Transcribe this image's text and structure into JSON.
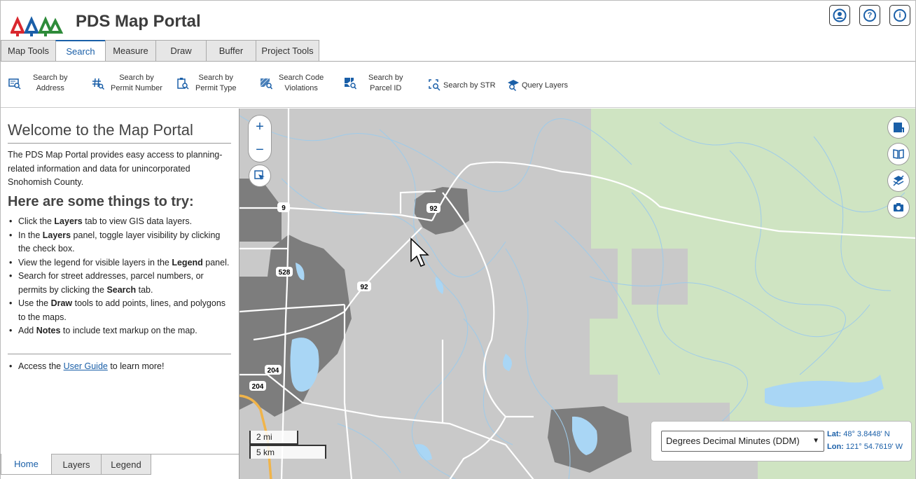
{
  "header": {
    "title": "PDS Map Portal",
    "icons": [
      "user-icon",
      "help-icon",
      "info-icon"
    ]
  },
  "tabs": [
    {
      "label": "Map Tools"
    },
    {
      "label": "Search"
    },
    {
      "label": "Measure"
    },
    {
      "label": "Draw"
    },
    {
      "label": "Buffer"
    },
    {
      "label": "Project Tools"
    }
  ],
  "toolbar": {
    "search_address": [
      "Search by",
      "Address"
    ],
    "search_permit_number": [
      "Search by",
      "Permit Number"
    ],
    "search_permit_type": [
      "Search by",
      "Permit Type"
    ],
    "search_code_violations": [
      "Search Code",
      "Violations"
    ],
    "search_parcel_id": [
      "Search by",
      "Parcel ID"
    ],
    "search_str": "Search by STR",
    "query_layers": "Query Layers"
  },
  "left": {
    "welcome": "Welcome to the Map Portal",
    "intro": "The PDS Map Portal provides easy access to planning-related information and data for unincorporated Snohomish County.",
    "try_title": "Here are some things to try:",
    "tips": {
      "t1a": "Click the ",
      "t1b": "Layers",
      "t1c": " tab to view GIS data layers.",
      "t2a": "In the ",
      "t2b": "Layers",
      "t2c": " panel, toggle layer visibility by clicking the check box.",
      "t3a": "View the legend for visible layers in the ",
      "t3b": "Legend",
      "t3c": " panel.",
      "t4a": "Search for street addresses, parcel numbers, or permits by clicking the ",
      "t4b": "Search",
      "t4c": " tab.",
      "t5a": "Use the ",
      "t5b": "Draw",
      "t5c": " tools to add points, lines, and polygons to the maps.",
      "t6a": "Add ",
      "t6b": "Notes",
      "t6c": " to include text markup on the map."
    },
    "guide_a": "Access the ",
    "guide_link": "User Guide",
    "guide_c": " to learn more!",
    "bottom_tabs": [
      {
        "label": "Home"
      },
      {
        "label": "Layers"
      },
      {
        "label": "Legend"
      }
    ]
  },
  "map": {
    "zoom_in": "+",
    "zoom_out": "−",
    "route_labels": {
      "r9": "9",
      "r92a": "92",
      "r528": "528",
      "r92b": "92",
      "r204a": "204",
      "r204b": "204"
    },
    "scale_mi": "2 mi",
    "scale_km": "5 km",
    "coord_format": "Degrees Decimal Minutes (DDM)",
    "lat_label": "Lat:",
    "lat_value": "48° 3.8448' N",
    "lon_label": "Lon:",
    "lon_value": "121° 54.7619' W",
    "side_icons": [
      "map-swap-icon",
      "book-icon",
      "layers-off-icon",
      "camera-icon"
    ]
  },
  "colors": {
    "accent": "#1a5fa8",
    "water": "#a9d6f5",
    "forest": "#cfe4c2",
    "urban": "#7d7d7d",
    "land": "#c9c9c9"
  }
}
